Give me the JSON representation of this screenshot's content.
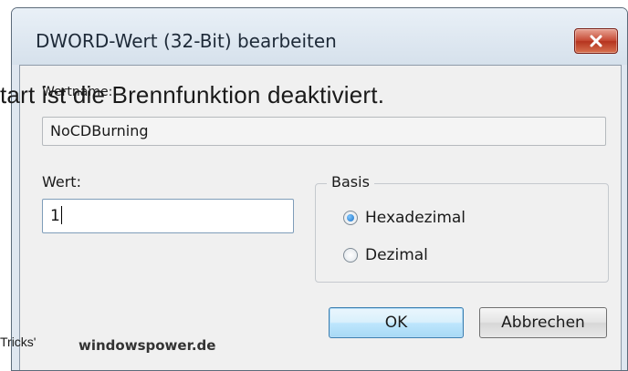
{
  "dialog": {
    "title": "DWORD-Wert (32-Bit) bearbeiten",
    "close_icon": "close-icon",
    "value_name_label": "Wertname:",
    "value_name": "NoCDBurning",
    "value_label": "Wert:",
    "value": "1",
    "base_group_label": "Basis",
    "radio_hex_label": "Hexadezimal",
    "radio_dec_label": "Dezimal",
    "selected_base": "Hexadezimal",
    "ok_label": "OK",
    "cancel_label": "Abbrechen"
  },
  "overlay": {
    "headline": "tart ist die Brennfunktion deaktiviert.",
    "footer_left": "Tricks'",
    "footer_brand": "windowspower.de"
  },
  "colors": {
    "close_button": "#c64a35",
    "default_button_border": "#3c7fb1",
    "radio_selected": "#1a6fc4"
  }
}
